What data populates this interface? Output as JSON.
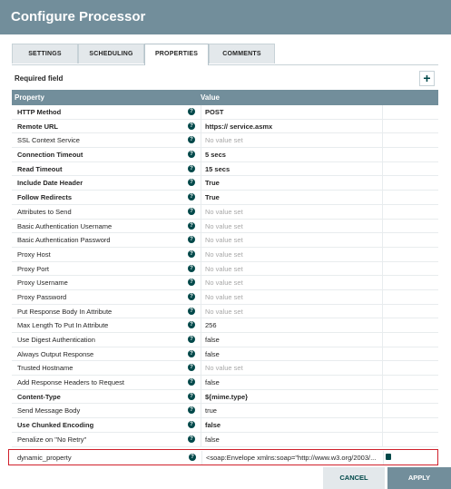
{
  "dialog": {
    "title": "Configure Processor"
  },
  "tabs": [
    {
      "label": "SETTINGS"
    },
    {
      "label": "SCHEDULING"
    },
    {
      "label": "PROPERTIES"
    },
    {
      "label": "COMMENTS"
    }
  ],
  "required_label": "Required field",
  "add_label": "+",
  "table": {
    "headers": {
      "property": "Property",
      "value": "Value"
    },
    "rows": [
      {
        "name": "HTTP Method",
        "value": "POST",
        "bold": true,
        "empty": false
      },
      {
        "name": "Remote URL",
        "value": "https:// service.asmx",
        "bold": true,
        "empty": false
      },
      {
        "name": "SSL Context Service",
        "value": "No value set",
        "bold": false,
        "empty": true
      },
      {
        "name": "Connection Timeout",
        "value": "5 secs",
        "bold": true,
        "empty": false
      },
      {
        "name": "Read Timeout",
        "value": "15 secs",
        "bold": true,
        "empty": false
      },
      {
        "name": "Include Date Header",
        "value": "True",
        "bold": true,
        "empty": false
      },
      {
        "name": "Follow Redirects",
        "value": "True",
        "bold": true,
        "empty": false
      },
      {
        "name": "Attributes to Send",
        "value": "No value set",
        "bold": false,
        "empty": true
      },
      {
        "name": "Basic Authentication Username",
        "value": "No value set",
        "bold": false,
        "empty": true
      },
      {
        "name": "Basic Authentication Password",
        "value": "No value set",
        "bold": false,
        "empty": true
      },
      {
        "name": "Proxy Host",
        "value": "No value set",
        "bold": false,
        "empty": true
      },
      {
        "name": "Proxy Port",
        "value": "No value set",
        "bold": false,
        "empty": true
      },
      {
        "name": "Proxy Username",
        "value": "No value set",
        "bold": false,
        "empty": true
      },
      {
        "name": "Proxy Password",
        "value": "No value set",
        "bold": false,
        "empty": true
      },
      {
        "name": "Put Response Body In Attribute",
        "value": "No value set",
        "bold": false,
        "empty": true
      },
      {
        "name": "Max Length To Put In Attribute",
        "value": "256",
        "bold": false,
        "empty": false
      },
      {
        "name": "Use Digest Authentication",
        "value": "false",
        "bold": false,
        "empty": false
      },
      {
        "name": "Always Output Response",
        "value": "false",
        "bold": false,
        "empty": false
      },
      {
        "name": "Trusted Hostname",
        "value": "No value set",
        "bold": false,
        "empty": true
      },
      {
        "name": "Add Response Headers to Request",
        "value": "false",
        "bold": false,
        "empty": false
      },
      {
        "name": "Content-Type",
        "value": "${mime.type}",
        "bold": true,
        "empty": false
      },
      {
        "name": "Send Message Body",
        "value": "true",
        "bold": false,
        "empty": false
      },
      {
        "name": "Use Chunked Encoding",
        "value": "false",
        "bold": true,
        "empty": false
      },
      {
        "name": "Penalize on \"No Retry\"",
        "value": "false",
        "bold": false,
        "empty": false
      }
    ],
    "dynamic": {
      "name": "dynamic_property",
      "value": "<soap:Envelope xmlns:soap=\"http://www.w3.org/2003/..."
    }
  },
  "buttons": {
    "cancel": "CANCEL",
    "apply": "APPLY"
  },
  "colors": {
    "header": "#728e9b",
    "accent": "#004849",
    "highlight": "#d0202b"
  }
}
